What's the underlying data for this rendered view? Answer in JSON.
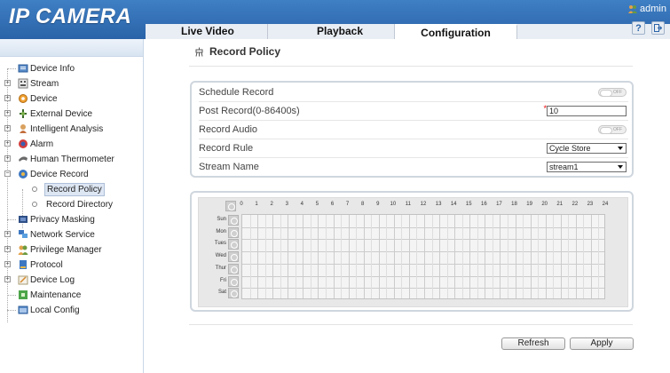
{
  "app": {
    "logo": "IP CAMERA",
    "user": "admin"
  },
  "tabs": [
    {
      "label": "Live Video"
    },
    {
      "label": "Playback"
    },
    {
      "label": "Configuration"
    }
  ],
  "sidebar": {
    "items": [
      {
        "label": "Device Info",
        "icon": "device-info-icon"
      },
      {
        "label": "Stream",
        "icon": "stream-icon"
      },
      {
        "label": "Device",
        "icon": "device-icon"
      },
      {
        "label": "External Device",
        "icon": "external-device-icon"
      },
      {
        "label": "Intelligent Analysis",
        "icon": "intelligent-analysis-icon"
      },
      {
        "label": "Alarm",
        "icon": "alarm-icon"
      },
      {
        "label": "Human Thermometer",
        "icon": "thermometer-icon"
      },
      {
        "label": "Device Record",
        "icon": "device-record-icon"
      },
      {
        "label": "Record Policy",
        "icon": "record-policy-node-icon"
      },
      {
        "label": "Record Directory",
        "icon": "record-directory-node-icon"
      },
      {
        "label": "Privacy Masking",
        "icon": "privacy-masking-icon"
      },
      {
        "label": "Network Service",
        "icon": "network-service-icon"
      },
      {
        "label": "Privilege Manager",
        "icon": "privilege-manager-icon"
      },
      {
        "label": "Protocol",
        "icon": "protocol-icon"
      },
      {
        "label": "Device Log",
        "icon": "device-log-icon"
      },
      {
        "label": "Maintenance",
        "icon": "maintenance-icon"
      },
      {
        "label": "Local Config",
        "icon": "local-config-icon"
      }
    ],
    "selected": "Record Policy"
  },
  "page": {
    "title": "Record Policy"
  },
  "form": {
    "schedule_record": {
      "label": "Schedule Record",
      "toggle": "OFF"
    },
    "post_record": {
      "label": "Post Record(0-86400s)",
      "required_mark": "*",
      "value": "10"
    },
    "record_audio": {
      "label": "Record Audio",
      "toggle": "OFF"
    },
    "record_rule": {
      "label": "Record Rule",
      "value": "Cycle Store"
    },
    "stream_name": {
      "label": "Stream Name",
      "value": "stream1"
    }
  },
  "schedule": {
    "hours": [
      "0",
      "1",
      "2",
      "3",
      "4",
      "5",
      "6",
      "7",
      "8",
      "9",
      "10",
      "11",
      "12",
      "13",
      "14",
      "15",
      "16",
      "17",
      "18",
      "19",
      "20",
      "21",
      "22",
      "23",
      "24"
    ],
    "days": [
      "Sun",
      "Mon",
      "Tues",
      "Wed",
      "Thur",
      "Fri",
      "Sat"
    ]
  },
  "buttons": {
    "refresh": "Refresh",
    "apply": "Apply"
  },
  "colors": {
    "header": "#2a63a8",
    "panel_border": "#cfd6de",
    "selected_bg": "#dde6f3"
  }
}
